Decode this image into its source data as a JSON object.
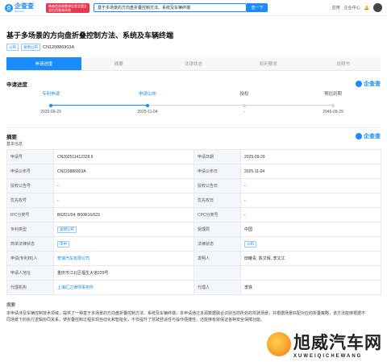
{
  "topbar": {
    "logo_text": "企查查",
    "logo_sub": "Qcc.com",
    "promo": "韩森首选和靠谱信息全国企业信用查询系统",
    "search_value": "基于多场景的方向盘折叠控制方法、系统及车辆终端",
    "search_button": "查一下",
    "app_label": "应用",
    "center_label": "企业中心"
  },
  "title": "基于多场景的方向盘折叠控制方法、系统及车辆终端",
  "tags": [
    "公布",
    "发明公布"
  ],
  "patent_no": "CN120886903A",
  "tabs": [
    "申请进度",
    "摘要",
    "法律状态",
    "权利要求",
    "说明书"
  ],
  "progress_section": {
    "title": "申请进度",
    "brand": "企查查"
  },
  "progress": [
    {
      "label": "专利申请",
      "date": "2025-09-29",
      "done": true
    },
    {
      "label": "申请公布",
      "date": "2025-11-04",
      "done": true
    },
    {
      "label": "授权",
      "date": "-",
      "done": false
    },
    {
      "label": "预估到期",
      "date": "2045-09-29",
      "done": false
    }
  ],
  "abstract_section": {
    "title": "摘要",
    "brand": "企查查",
    "sub": "基本信息"
  },
  "info_rows": [
    {
      "k1": "申请号",
      "v1": "CN202511412328.9",
      "k2": "申请日期",
      "v2": "2025-09-29"
    },
    {
      "k1": "申请公布号",
      "v1": "CN120886903A",
      "k2": "申请公布日",
      "v2": "2025-11-04"
    },
    {
      "k1": "授权公告号",
      "v1": "-",
      "k2": "授权公告日",
      "v2": "-"
    },
    {
      "k1": "优先权号",
      "v1": "-",
      "k2": "优先权日",
      "v2": "-"
    },
    {
      "k1": "IPC分类号",
      "v1": "B62D1/04; B60R16/023",
      "k2": "CPC分类号",
      "v2": "-"
    },
    {
      "k1": "专利类型",
      "v1": "发明公布",
      "k2": "受理局",
      "v2": "中国"
    },
    {
      "k1": "简单法律状态",
      "v1": "审中",
      "k2": "法律状态",
      "v2": "公布"
    },
    {
      "k1": "申请(专利权)人",
      "v1": "奇瑞汽车有限公司",
      "k2": "发明人",
      "v2": "田曦青, 陈文辉, 李文江"
    },
    {
      "k1": "申请人地址",
      "v1": "重庆市江北区福生大道229号",
      "k2": "",
      "v2": ""
    },
    {
      "k1": "代理机构",
      "v1": "上海汇之律师事务所",
      "k2": "代理人",
      "v2": "李铁"
    }
  ],
  "abstract_label": "摘要",
  "abstract_text": "本申请涉及车辆控制技术领域，提供了一种基于多场景的方向盘折叠控制方法、系统及车辆终端，本申请通过多源数据融合识别当前所处的驾驶场景，并根据场景匹配对应的折叠策略，该方法能够根据不同场景下的执行逻辑协同关系，使折叠控制过程实现自动化和智能化，不仅提升了驾驶舒适性与操作便捷性，还能够有效保证各种安全保障功能。",
  "watermark": {
    "cn": "旭威汽车网",
    "en": "XUWEIQICHEWANG"
  }
}
